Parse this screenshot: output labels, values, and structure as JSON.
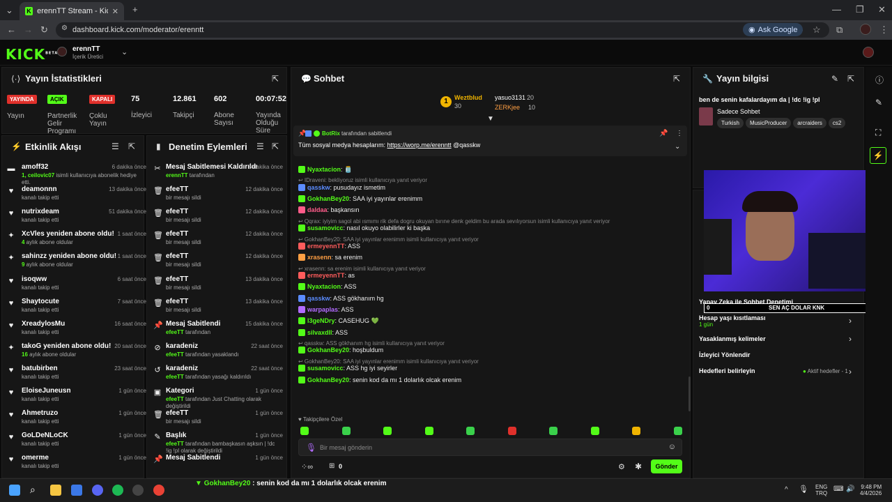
{
  "browser": {
    "tab_title": "erennTT Stream - Kick Dashbo",
    "url": "dashboard.kick.com/moderator/erenntt",
    "ask_google": "Ask Google"
  },
  "header": {
    "logo": "KICK",
    "logo_sup": "BETA",
    "channel_name": "erennTT",
    "channel_role": "İçerik Üretici"
  },
  "stats": {
    "title": "Yayın İstatistikleri",
    "items": [
      {
        "badge": "YAYINDA",
        "label": "Yayın"
      },
      {
        "badge": "AÇIK",
        "label": "Partnerlik Gelir Programı"
      },
      {
        "badge": "KAPALI",
        "label": "Çoklu Yayın"
      },
      {
        "value": "75",
        "label": "İzleyici"
      },
      {
        "value": "12.861",
        "label": "Takipçi"
      },
      {
        "value": "602",
        "label": "Abone Sayısı"
      },
      {
        "value": "00:07:52",
        "label": "Yayında Olduğu Süre"
      }
    ]
  },
  "activity": {
    "title": "Etkinlik Akışı",
    "items": [
      {
        "icon": "▬",
        "name": "amoff32",
        "sub_g": "1, ceilovic07",
        "sub": " isimli kullanıcıya abonelik hediye etti.",
        "time": "6 dakika önce"
      },
      {
        "icon": "♥",
        "name": "deamonnn",
        "sub_g": "",
        "sub": "kanalı takip etti",
        "time": "13 dakika önce"
      },
      {
        "icon": "♥",
        "name": "nutrixdeam",
        "sub_g": "",
        "sub": "kanalı takip etti",
        "time": "51 dakika önce"
      },
      {
        "icon": "✦",
        "name": "XcVles yeniden abone oldu!",
        "sub_g": "4",
        "sub": " aylık abone oldular",
        "time": "1 saat önce"
      },
      {
        "icon": "✦",
        "name": "sahinzz yeniden abone oldu!",
        "sub_g": "9",
        "sub": " aylık abone oldular",
        "time": "1 saat önce"
      },
      {
        "icon": "♥",
        "name": "isoqww",
        "sub_g": "",
        "sub": "kanalı takip etti",
        "time": "6 saat önce"
      },
      {
        "icon": "♥",
        "name": "Shaytocute",
        "sub_g": "",
        "sub": "kanalı takip etti",
        "time": "7 saat önce"
      },
      {
        "icon": "♥",
        "name": "XreadylosMu",
        "sub_g": "",
        "sub": "kanalı takip etti",
        "time": "16 saat önce"
      },
      {
        "icon": "✦",
        "name": "takoG yeniden abone oldu!",
        "sub_g": "16",
        "sub": " aylık abone oldular",
        "time": "20 saat önce"
      },
      {
        "icon": "♥",
        "name": "batubirben",
        "sub_g": "",
        "sub": "kanalı takip etti",
        "time": "23 saat önce"
      },
      {
        "icon": "♥",
        "name": "EloiseJuneusn",
        "sub_g": "",
        "sub": "kanalı takip etti",
        "time": "1 gün önce"
      },
      {
        "icon": "♥",
        "name": "Ahmetruzo",
        "sub_g": "",
        "sub": "kanalı takip etti",
        "time": "1 gün önce"
      },
      {
        "icon": "♥",
        "name": "GoLDeNLoCK",
        "sub_g": "",
        "sub": "kanalı takip etti",
        "time": "1 gün önce"
      },
      {
        "icon": "♥",
        "name": "omerme",
        "sub_g": "",
        "sub": "kanalı takip etti",
        "time": "1 gün önce"
      }
    ]
  },
  "moderation": {
    "title": "Denetim Eylemleri",
    "items": [
      {
        "icon": "✂",
        "name": "Mesaj Sabitlemesi Kaldırıldı",
        "sub_g": "erennTT",
        "sub": " tarafından",
        "time": "8 dakika önce"
      },
      {
        "icon": "🗑",
        "name": "efeeTT",
        "sub_g": "",
        "sub": "bir mesajı sildi",
        "time": "12 dakika önce"
      },
      {
        "icon": "🗑",
        "name": "efeeTT",
        "sub_g": "",
        "sub": "bir mesajı sildi",
        "time": "12 dakika önce"
      },
      {
        "icon": "🗑",
        "name": "efeeTT",
        "sub_g": "",
        "sub": "bir mesajı sildi",
        "time": "12 dakika önce"
      },
      {
        "icon": "🗑",
        "name": "efeeTT",
        "sub_g": "",
        "sub": "bir mesajı sildi",
        "time": "12 dakika önce"
      },
      {
        "icon": "🗑",
        "name": "efeeTT",
        "sub_g": "",
        "sub": "bir mesajı sildi",
        "time": "13 dakika önce"
      },
      {
        "icon": "🗑",
        "name": "efeeTT",
        "sub_g": "",
        "sub": "bir mesajı sildi",
        "time": "13 dakika önce"
      },
      {
        "icon": "📌",
        "name": "Mesaj Sabitlendi",
        "sub_g": "efeeTT",
        "sub": " tarafından",
        "time": "15 dakika önce"
      },
      {
        "icon": "⊘",
        "name": "karadeniz",
        "sub_g": "efeeTT",
        "sub": " tarafından yasaklandı",
        "time": "22 saat önce"
      },
      {
        "icon": "↺",
        "name": "karadeniz",
        "sub_g": "efeeTT",
        "sub": " tarafından yasağı kaldırıldı",
        "time": "22 saat önce"
      },
      {
        "icon": "▣",
        "name": "Kategori",
        "sub_g": "efeeTT",
        "sub": " tarafından Just Chatting olarak değiştirildi",
        "time": "1 gün önce"
      },
      {
        "icon": "🗑",
        "name": "efeeTT",
        "sub_g": "",
        "sub": "bir mesajı sildi",
        "time": "1 gün önce"
      },
      {
        "icon": "✎",
        "name": "Başlık",
        "sub_g": "efeeTT",
        "sub": " tarafından bambaşkasın aşksın | !dc !ig !pl olarak değiştirildi",
        "time": "1 gün önce"
      },
      {
        "icon": "📌",
        "name": "Mesaj Sabitlendi",
        "sub_g": "",
        "sub": "",
        "time": "1 gün önce"
      }
    ]
  },
  "chat": {
    "title": "Sohbet",
    "leaderboard": {
      "first": {
        "name": "Weztblud",
        "count": "30"
      },
      "second": {
        "name": "yasuo3131",
        "count": "20"
      },
      "third": {
        "name": "ZERKjee",
        "count": "10"
      }
    },
    "pinned": {
      "by": "BotRix",
      "by_suffix": " tarafından sabitlendi",
      "text": "Tüm sosyal medya hesaplarım: ",
      "link": "https://worp.me/erenntt",
      "mention": " @qasskw"
    },
    "messages": [
      {
        "type": "msg",
        "user": "Nyaxtacion",
        "color": "#53fc18",
        "text": ": 🫙"
      },
      {
        "type": "reply",
        "text": "↩ IDraveni: bekliyoruz isimli kullanıcıya yanıt veriyor"
      },
      {
        "type": "msg",
        "user": "qasskw",
        "color": "#5b8cff",
        "text": ": pusudayız ismetim"
      },
      {
        "type": "msg",
        "user": "GokhanBey20",
        "color": "#53fc18",
        "text": ": SAA iyi yayınlar erenimm"
      },
      {
        "type": "msg",
        "user": "daldaa",
        "color": "#ff5c8a",
        "text": ": başkansın"
      },
      {
        "type": "reply",
        "text": "↩ Qqrax: iyiyim sagol abi ısmımı rik defa dogru okuyan bırıne denk geldim bu arada sevılıyorsun isimli kullanıcıya yanıt veriyor"
      },
      {
        "type": "msg",
        "user": "susamovicc",
        "color": "#53fc18",
        "text": ": nasıl okuyo olabilirler ki başka"
      },
      {
        "type": "reply",
        "text": "↩ GokhanBey20: SAA iyi yayınlar erenimm isimli kullanıcıya yanıt veriyor"
      },
      {
        "type": "msg",
        "user": "ermeyennTT",
        "color": "#ff5c5c",
        "text": ": ASS"
      },
      {
        "type": "msg",
        "user": "xrasenn",
        "color": "#ff9f43",
        "text": ": sa erenim"
      },
      {
        "type": "reply",
        "text": "↩ xrasenn: sa erenim isimli kullanıcıya yanıt veriyor"
      },
      {
        "type": "msg",
        "user": "ermeyennTT",
        "color": "#ff5c5c",
        "text": ": as"
      },
      {
        "type": "msg",
        "user": "Nyaxtacion",
        "color": "#53fc18",
        "text": ": ASS"
      },
      {
        "type": "msg",
        "user": "qasskw",
        "color": "#5b8cff",
        "text": ": ASS gökhanım hg"
      },
      {
        "type": "msg",
        "user": "warpaplas",
        "color": "#b26bff",
        "text": ": ASS"
      },
      {
        "type": "msg",
        "user": "l3geNDry",
        "color": "#53fc18",
        "text": ": CASEHUG 💚"
      },
      {
        "type": "msg",
        "user": "silvaxdll",
        "color": "#53fc18",
        "text": ": ASS"
      },
      {
        "type": "reply",
        "text": "↩ qasskw: ASS gökhanım hg isimli kullanıcıya yanıt veriyor"
      },
      {
        "type": "msg",
        "user": "GokhanBey20",
        "color": "#53fc18",
        "text": ": hoşbuldum"
      },
      {
        "type": "reply",
        "text": "↩ GokhanBey20: SAA iyi yayınlar erenimm isimli kullanıcıya yanıt veriyor"
      },
      {
        "type": "msg",
        "user": "susamovicc",
        "color": "#53fc18",
        "text": ": ASS hg iyi seyirler"
      },
      {
        "type": "msg",
        "user": "GokhanBey20",
        "color": "#53fc18",
        "text": ": senin kod da mı 1 dolarlık olcak erenim"
      }
    ],
    "follower_only": "♥ Takipçilere Özel",
    "input_placeholder": "Bir mesaj gönderin",
    "points": "0",
    "send_label": "Gönder"
  },
  "stream_info": {
    "title": "Yayın bilgisi",
    "stream_title": "ben de senin kafalardayım da | !dc !ig !pl",
    "category": "Sadece Sohbet",
    "tags": [
      "Turkish",
      "MusicProducer",
      "arcraiders",
      "cs2"
    ]
  },
  "overlay": {
    "ai_title": "Yapay Zeka ile Sohbet Denetimi",
    "goal_left": "0",
    "goal_text": "SEN AÇ DOLAR KNK",
    "goal_right": "10"
  },
  "settings": {
    "age_restriction": "Hesap yaşı kısıtlaması",
    "age_value": "1 gün",
    "banned_words": "Yasaklanmış kelimeler",
    "viewer_redirect": "İzleyici Yönlendir",
    "goals": "Hedefleri belirleyin",
    "goals_status": "Aktif hedefler - 1"
  },
  "taskbar": {
    "lang_top": "ENG",
    "lang_bottom": "TRQ",
    "time": "9:48 PM",
    "date": "4/4/2026",
    "ticker_user": "GokhanBey20",
    "ticker_text": " : senin kod da mı 1 dolarlık olcak erenim"
  }
}
